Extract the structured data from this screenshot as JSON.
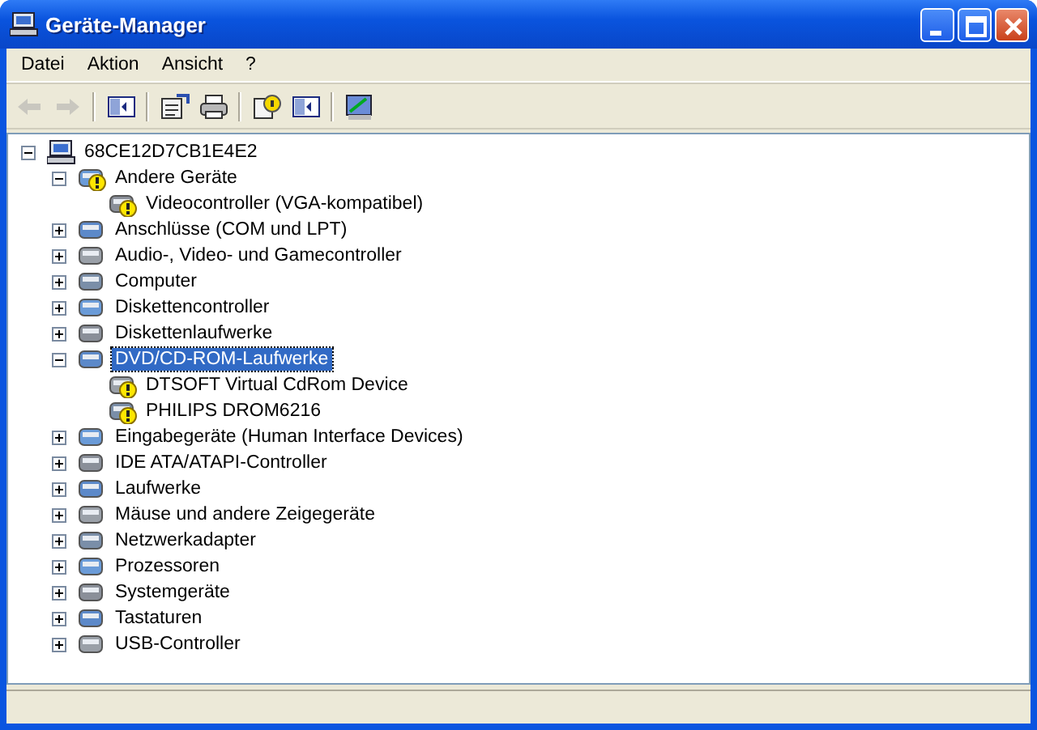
{
  "window": {
    "title": "Geräte-Manager"
  },
  "menu": [
    "Datei",
    "Aktion",
    "Ansicht",
    "?"
  ],
  "toolbar_groups": [
    [
      {
        "disabled": true
      },
      {
        "disabled": true
      }
    ],
    [
      {
        "disabled": false
      }
    ],
    [
      {
        "disabled": false
      },
      {
        "disabled": false
      }
    ],
    [
      {
        "disabled": false
      },
      {
        "disabled": false
      }
    ],
    [
      {
        "disabled": false
      }
    ]
  ],
  "tree": {
    "label": "68CE12D7CB1E4E2",
    "expanded": true,
    "selected": false,
    "children": [
      {
        "label": "Andere Geräte",
        "expanded": true,
        "selected": false,
        "problem": true,
        "children": [
          {
            "label": "Videocontroller (VGA-kompatibel)",
            "selected": false,
            "problem": true
          }
        ]
      },
      {
        "label": "Anschlüsse (COM und LPT)",
        "expanded": false,
        "selected": false,
        "problem": false
      },
      {
        "label": "Audio-, Video- und Gamecontroller",
        "expanded": false,
        "selected": false,
        "problem": false
      },
      {
        "label": "Computer",
        "expanded": false,
        "selected": false,
        "problem": false
      },
      {
        "label": "Diskettencontroller",
        "expanded": false,
        "selected": false,
        "problem": false
      },
      {
        "label": "Diskettenlaufwerke",
        "expanded": false,
        "selected": false,
        "problem": false
      },
      {
        "label": "DVD/CD-ROM-Laufwerke",
        "expanded": true,
        "selected": true,
        "problem": false,
        "children": [
          {
            "label": "DTSOFT Virtual CdRom Device",
            "selected": false,
            "problem": true
          },
          {
            "label": "PHILIPS DROM6216",
            "selected": false,
            "problem": true
          }
        ]
      },
      {
        "label": "Eingabegeräte (Human Interface Devices)",
        "expanded": false,
        "selected": false,
        "problem": false
      },
      {
        "label": "IDE ATA/ATAPI-Controller",
        "expanded": false,
        "selected": false,
        "problem": false
      },
      {
        "label": "Laufwerke",
        "expanded": false,
        "selected": false,
        "problem": false
      },
      {
        "label": "Mäuse und andere Zeigegeräte",
        "expanded": false,
        "selected": false,
        "problem": false
      },
      {
        "label": "Netzwerkadapter",
        "expanded": false,
        "selected": false,
        "problem": false
      },
      {
        "label": "Prozessoren",
        "expanded": false,
        "selected": false,
        "problem": false
      },
      {
        "label": "Systemgeräte",
        "expanded": false,
        "selected": false,
        "problem": false
      },
      {
        "label": "Tastaturen",
        "expanded": false,
        "selected": false,
        "problem": false
      },
      {
        "label": "USB-Controller",
        "expanded": false,
        "selected": false,
        "problem": false
      }
    ]
  }
}
